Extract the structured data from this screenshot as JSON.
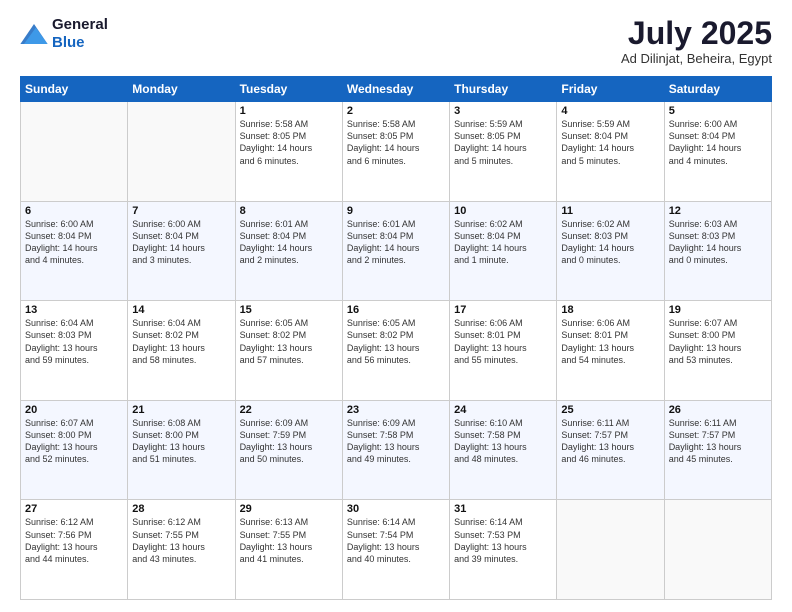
{
  "header": {
    "logo_general": "General",
    "logo_blue": "Blue",
    "title": "July 2025",
    "location": "Ad Dilinjat, Beheira, Egypt"
  },
  "calendar": {
    "days_of_week": [
      "Sunday",
      "Monday",
      "Tuesday",
      "Wednesday",
      "Thursday",
      "Friday",
      "Saturday"
    ],
    "weeks": [
      [
        {
          "day": "",
          "content": ""
        },
        {
          "day": "",
          "content": ""
        },
        {
          "day": "1",
          "content": "Sunrise: 5:58 AM\nSunset: 8:05 PM\nDaylight: 14 hours\nand 6 minutes."
        },
        {
          "day": "2",
          "content": "Sunrise: 5:58 AM\nSunset: 8:05 PM\nDaylight: 14 hours\nand 6 minutes."
        },
        {
          "day": "3",
          "content": "Sunrise: 5:59 AM\nSunset: 8:05 PM\nDaylight: 14 hours\nand 5 minutes."
        },
        {
          "day": "4",
          "content": "Sunrise: 5:59 AM\nSunset: 8:04 PM\nDaylight: 14 hours\nand 5 minutes."
        },
        {
          "day": "5",
          "content": "Sunrise: 6:00 AM\nSunset: 8:04 PM\nDaylight: 14 hours\nand 4 minutes."
        }
      ],
      [
        {
          "day": "6",
          "content": "Sunrise: 6:00 AM\nSunset: 8:04 PM\nDaylight: 14 hours\nand 4 minutes."
        },
        {
          "day": "7",
          "content": "Sunrise: 6:00 AM\nSunset: 8:04 PM\nDaylight: 14 hours\nand 3 minutes."
        },
        {
          "day": "8",
          "content": "Sunrise: 6:01 AM\nSunset: 8:04 PM\nDaylight: 14 hours\nand 2 minutes."
        },
        {
          "day": "9",
          "content": "Sunrise: 6:01 AM\nSunset: 8:04 PM\nDaylight: 14 hours\nand 2 minutes."
        },
        {
          "day": "10",
          "content": "Sunrise: 6:02 AM\nSunset: 8:04 PM\nDaylight: 14 hours\nand 1 minute."
        },
        {
          "day": "11",
          "content": "Sunrise: 6:02 AM\nSunset: 8:03 PM\nDaylight: 14 hours\nand 0 minutes."
        },
        {
          "day": "12",
          "content": "Sunrise: 6:03 AM\nSunset: 8:03 PM\nDaylight: 14 hours\nand 0 minutes."
        }
      ],
      [
        {
          "day": "13",
          "content": "Sunrise: 6:04 AM\nSunset: 8:03 PM\nDaylight: 13 hours\nand 59 minutes."
        },
        {
          "day": "14",
          "content": "Sunrise: 6:04 AM\nSunset: 8:02 PM\nDaylight: 13 hours\nand 58 minutes."
        },
        {
          "day": "15",
          "content": "Sunrise: 6:05 AM\nSunset: 8:02 PM\nDaylight: 13 hours\nand 57 minutes."
        },
        {
          "day": "16",
          "content": "Sunrise: 6:05 AM\nSunset: 8:02 PM\nDaylight: 13 hours\nand 56 minutes."
        },
        {
          "day": "17",
          "content": "Sunrise: 6:06 AM\nSunset: 8:01 PM\nDaylight: 13 hours\nand 55 minutes."
        },
        {
          "day": "18",
          "content": "Sunrise: 6:06 AM\nSunset: 8:01 PM\nDaylight: 13 hours\nand 54 minutes."
        },
        {
          "day": "19",
          "content": "Sunrise: 6:07 AM\nSunset: 8:00 PM\nDaylight: 13 hours\nand 53 minutes."
        }
      ],
      [
        {
          "day": "20",
          "content": "Sunrise: 6:07 AM\nSunset: 8:00 PM\nDaylight: 13 hours\nand 52 minutes."
        },
        {
          "day": "21",
          "content": "Sunrise: 6:08 AM\nSunset: 8:00 PM\nDaylight: 13 hours\nand 51 minutes."
        },
        {
          "day": "22",
          "content": "Sunrise: 6:09 AM\nSunset: 7:59 PM\nDaylight: 13 hours\nand 50 minutes."
        },
        {
          "day": "23",
          "content": "Sunrise: 6:09 AM\nSunset: 7:58 PM\nDaylight: 13 hours\nand 49 minutes."
        },
        {
          "day": "24",
          "content": "Sunrise: 6:10 AM\nSunset: 7:58 PM\nDaylight: 13 hours\nand 48 minutes."
        },
        {
          "day": "25",
          "content": "Sunrise: 6:11 AM\nSunset: 7:57 PM\nDaylight: 13 hours\nand 46 minutes."
        },
        {
          "day": "26",
          "content": "Sunrise: 6:11 AM\nSunset: 7:57 PM\nDaylight: 13 hours\nand 45 minutes."
        }
      ],
      [
        {
          "day": "27",
          "content": "Sunrise: 6:12 AM\nSunset: 7:56 PM\nDaylight: 13 hours\nand 44 minutes."
        },
        {
          "day": "28",
          "content": "Sunrise: 6:12 AM\nSunset: 7:55 PM\nDaylight: 13 hours\nand 43 minutes."
        },
        {
          "day": "29",
          "content": "Sunrise: 6:13 AM\nSunset: 7:55 PM\nDaylight: 13 hours\nand 41 minutes."
        },
        {
          "day": "30",
          "content": "Sunrise: 6:14 AM\nSunset: 7:54 PM\nDaylight: 13 hours\nand 40 minutes."
        },
        {
          "day": "31",
          "content": "Sunrise: 6:14 AM\nSunset: 7:53 PM\nDaylight: 13 hours\nand 39 minutes."
        },
        {
          "day": "",
          "content": ""
        },
        {
          "day": "",
          "content": ""
        }
      ]
    ]
  }
}
